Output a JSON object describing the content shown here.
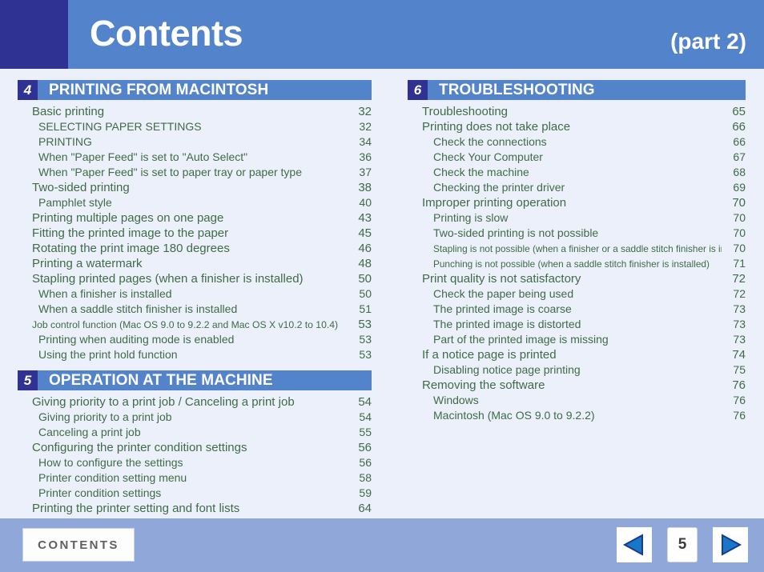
{
  "header": {
    "title": "Contents",
    "part": "(part 2)",
    "colors": {
      "bar": "#5383cb",
      "corner": "#2f3293"
    }
  },
  "footer": {
    "contents_label": "CONTENTS",
    "page_number": "5",
    "prev_icon": "prev-triangle-icon",
    "next_icon": "next-triangle-icon",
    "background": "#90a8d9"
  },
  "columns": {
    "left": [
      {
        "number": "4",
        "title": "PRINTING FROM MACINTOSH",
        "entries": [
          {
            "level": 1,
            "label": "Basic printing",
            "page": "32"
          },
          {
            "level": 2,
            "label": "SELECTING PAPER SETTINGS",
            "page": "32"
          },
          {
            "level": 2,
            "label": "PRINTING",
            "page": "34"
          },
          {
            "level": 2,
            "label": "When \"Paper Feed\" is set to \"Auto Select\"",
            "page": "36"
          },
          {
            "level": 2,
            "label": "When \"Paper Feed\" is set to paper tray or paper type",
            "page": "37"
          },
          {
            "level": 1,
            "label": "Two-sided printing",
            "page": "38"
          },
          {
            "level": 2,
            "label": "Pamphlet style",
            "page": "40"
          },
          {
            "level": 1,
            "label": "Printing multiple pages on one page",
            "page": "43"
          },
          {
            "level": 1,
            "label": "Fitting the printed image to the paper",
            "page": "45"
          },
          {
            "level": 1,
            "label": "Rotating the print image 180 degrees",
            "page": "46"
          },
          {
            "level": 1,
            "label": "Printing a watermark",
            "page": "48"
          },
          {
            "level": 1,
            "label": "Stapling printed pages (when a finisher is installed)",
            "page": "50"
          },
          {
            "level": 2,
            "label": "When a finisher is installed",
            "page": "50"
          },
          {
            "level": 2,
            "label": "When a saddle stitch finisher is installed",
            "page": "51"
          },
          {
            "level": 1,
            "condensed": true,
            "label": "Job control function (Mac OS 9.0 to 9.2.2 and Mac OS X v10.2 to 10.4)",
            "page": "53"
          },
          {
            "level": 2,
            "label": "Printing when auditing mode is enabled",
            "page": "53"
          },
          {
            "level": 2,
            "label": "Using the print hold function",
            "page": "53"
          }
        ]
      },
      {
        "number": "5",
        "title": "OPERATION AT THE MACHINE",
        "entries": [
          {
            "level": 1,
            "label": "Giving priority to a print job / Canceling a print job",
            "page": "54"
          },
          {
            "level": 2,
            "label": "Giving priority to a print job",
            "page": "54"
          },
          {
            "level": 2,
            "label": "Canceling a print job",
            "page": "55"
          },
          {
            "level": 1,
            "label": "Configuring the printer condition settings",
            "page": "56"
          },
          {
            "level": 2,
            "label": "How to configure the settings",
            "page": "56"
          },
          {
            "level": 2,
            "label": "Printer condition setting menu",
            "page": "58"
          },
          {
            "level": 2,
            "label": "Printer condition settings",
            "page": "59"
          },
          {
            "level": 1,
            "label": "Printing the printer setting and font lists",
            "page": "64"
          }
        ]
      }
    ],
    "right": [
      {
        "number": "6",
        "title": "TROUBLESHOOTING",
        "entries": [
          {
            "level": 1,
            "label": "Troubleshooting",
            "page": "65"
          },
          {
            "level": 1,
            "label": "Printing does not take place",
            "page": "66"
          },
          {
            "level": 2,
            "label": "Check the connections",
            "page": "66"
          },
          {
            "level": 2,
            "label": "Check Your Computer",
            "page": "67"
          },
          {
            "level": 2,
            "label": "Check the machine",
            "page": "68"
          },
          {
            "level": 2,
            "label": "Checking the printer driver",
            "page": "69"
          },
          {
            "level": 1,
            "label": "Improper printing operation",
            "page": "70"
          },
          {
            "level": 2,
            "label": "Printing is slow",
            "page": "70"
          },
          {
            "level": 2,
            "label": "Two-sided printing is not possible",
            "page": "70"
          },
          {
            "level": 2,
            "condensed2": true,
            "label": "Stapling is not possible (when a finisher or a saddle stitch finisher is installed)",
            "page": "70"
          },
          {
            "level": 2,
            "condensed2": true,
            "label": "Punching is not possible (when a saddle stitch finisher is installed)",
            "page": "71"
          },
          {
            "level": 1,
            "label": "Print quality is not satisfactory",
            "page": "72"
          },
          {
            "level": 2,
            "label": "Check the paper being used",
            "page": "72"
          },
          {
            "level": 2,
            "label": "The printed image is coarse",
            "page": "73"
          },
          {
            "level": 2,
            "label": "The printed image is distorted",
            "page": "73"
          },
          {
            "level": 2,
            "label": "Part of the printed image is missing",
            "page": "73"
          },
          {
            "level": 1,
            "label": "If a notice page is printed",
            "page": "74"
          },
          {
            "level": 2,
            "label": "Disabling notice page printing",
            "page": "75"
          },
          {
            "level": 1,
            "label": "Removing the software",
            "page": "76"
          },
          {
            "level": 2,
            "label": "Windows",
            "page": "76"
          },
          {
            "level": 2,
            "label": "Macintosh (Mac OS 9.0 to 9.2.2)",
            "page": "76"
          }
        ]
      }
    ]
  }
}
